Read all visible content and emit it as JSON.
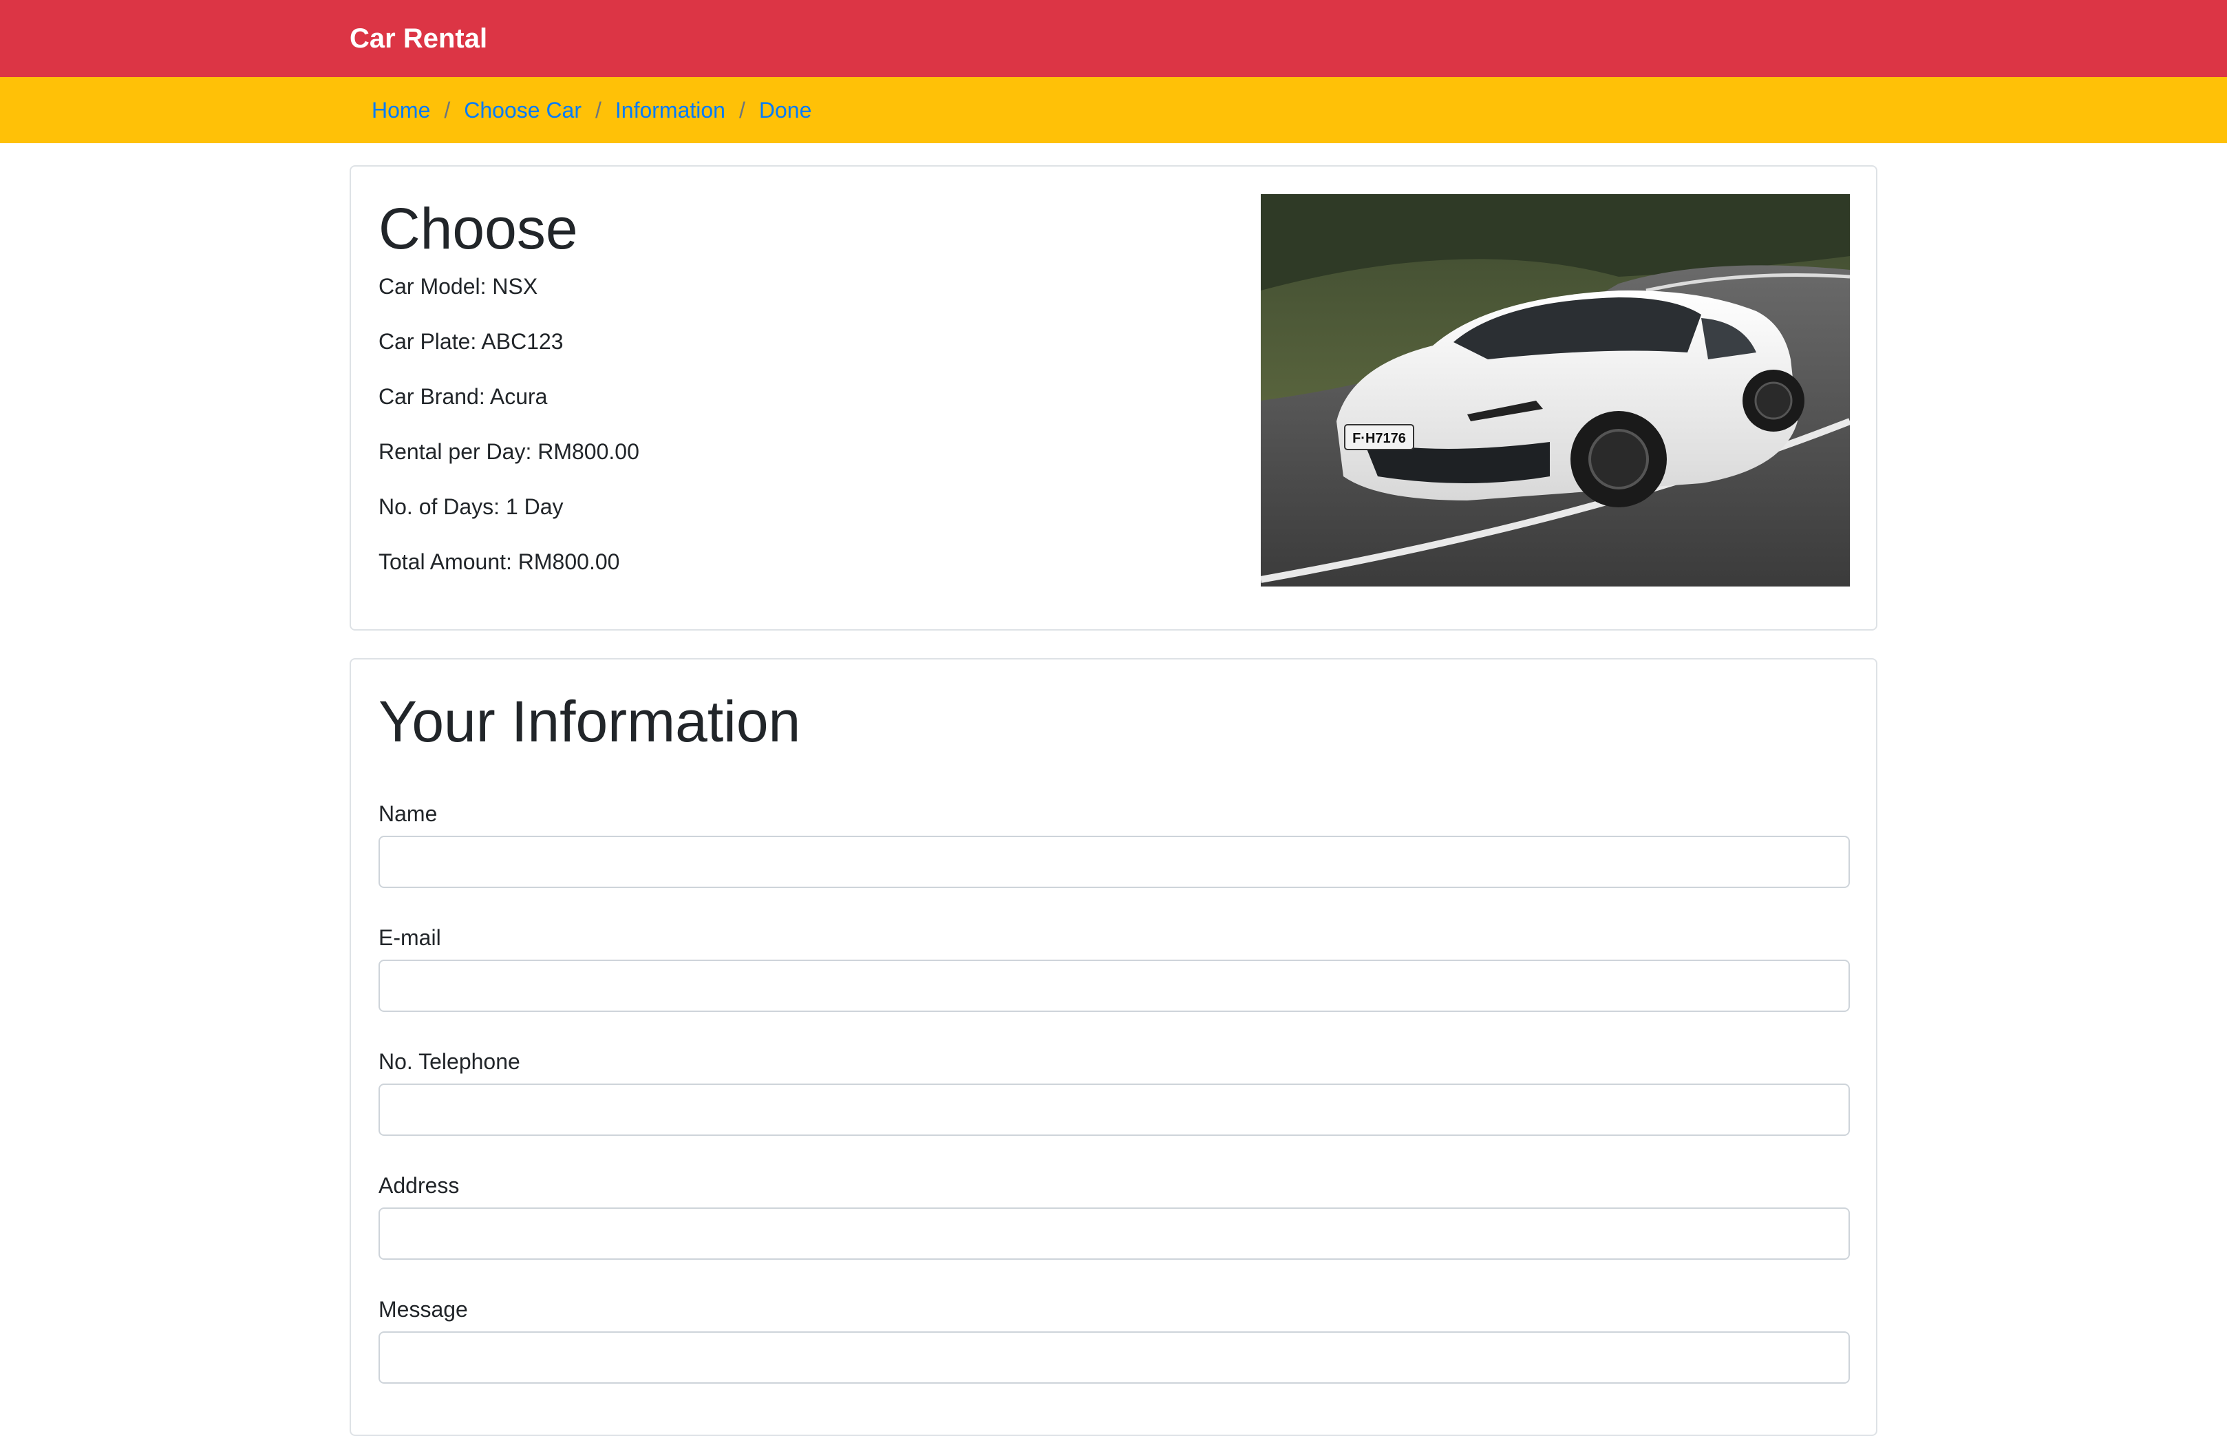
{
  "app": {
    "brand": "Car Rental"
  },
  "breadcrumb": [
    "Home",
    "Choose Car",
    "Information",
    "Done"
  ],
  "summary": {
    "title": "Choose",
    "lines": [
      "Car Model: NSX",
      "Car Plate: ABC123",
      "Car Brand: Acura",
      "Rental per Day: RM800.00",
      "No. of Days: 1 Day",
      "Total Amount: RM800.00"
    ],
    "plate_text": "F·H7176"
  },
  "form": {
    "title": "Your Information",
    "fields": [
      {
        "label": "Name",
        "value": ""
      },
      {
        "label": "E-mail",
        "value": ""
      },
      {
        "label": "No. Telephone",
        "value": ""
      },
      {
        "label": "Address",
        "value": ""
      },
      {
        "label": "Message",
        "value": ""
      }
    ]
  },
  "colors": {
    "navbar": "#dc3545",
    "breadcrumb_bar": "#ffc107",
    "link": "#007bff"
  }
}
